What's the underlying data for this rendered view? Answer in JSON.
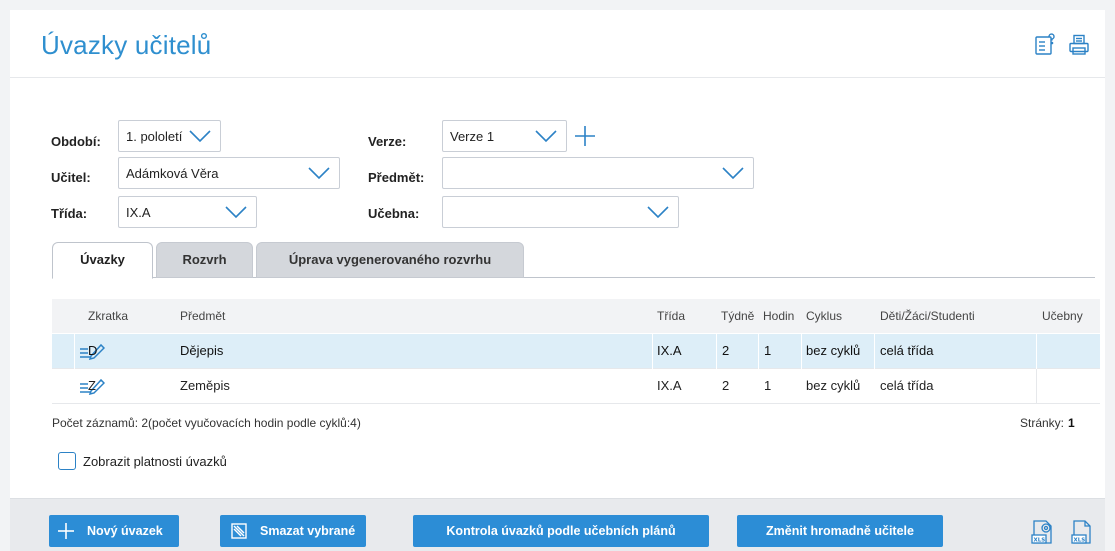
{
  "header": {
    "title": "Úvazky učitelů",
    "help_icon": "help-list-icon",
    "print_icon": "printer-icon"
  },
  "filters": {
    "period_label": "Období:",
    "period_value": "1. pololetí",
    "version_label": "Verze:",
    "version_value": "Verze 1",
    "teacher_label": "Učitel:",
    "teacher_value": "Adámková Věra",
    "subject_label": "Předmět:",
    "subject_value": "",
    "class_label": "Třída:",
    "class_value": "IX.A",
    "room_label": "Učebna:",
    "room_value": ""
  },
  "tabs": [
    {
      "label": "Úvazky",
      "active": true
    },
    {
      "label": "Rozvrh",
      "active": false
    },
    {
      "label": "Úprava vygenerovaného rozvrhu",
      "active": false
    }
  ],
  "table": {
    "columns": [
      "Zkratka",
      "Předmět",
      "Třída",
      "Týdně",
      "Hodin",
      "Cyklus",
      "Děti/Žáci/Studenti",
      "Učebny"
    ],
    "rows": [
      {
        "zkratka": "D",
        "predmet": "Dějepis",
        "trida": "IX.A",
        "tydne": "2",
        "hodin": "1",
        "cyklus": "bez cyklů",
        "deti": "celá třída",
        "ucebny": "",
        "selected": true
      },
      {
        "zkratka": "Z",
        "predmet": "Zeměpis",
        "trida": "IX.A",
        "tydne": "2",
        "hodin": "1",
        "cyklus": "bez cyklů",
        "deti": "celá třída",
        "ucebny": "",
        "selected": false
      }
    ]
  },
  "footer": {
    "count_text": "Počet záznamů: 2(počet vyučovacích hodin podle cyklů:4)",
    "pages_label": "Stránky:",
    "pages_value": "1"
  },
  "checkbox": {
    "label": "Zobrazit platnosti úvazků",
    "checked": false
  },
  "toolbar": {
    "new_label": "Nový úvazek",
    "delete_label": "Smazat vybrané",
    "check_label": "Kontrola úvazků podle učebních plánů",
    "change_label": "Změnit hromadně učitele",
    "export_icon_1": "xls-settings-icon",
    "export_icon_2": "xls-file-icon"
  },
  "colors": {
    "accent": "#2c8dd6",
    "title": "#2f8fcf",
    "selected_row": "#ddeef8"
  }
}
